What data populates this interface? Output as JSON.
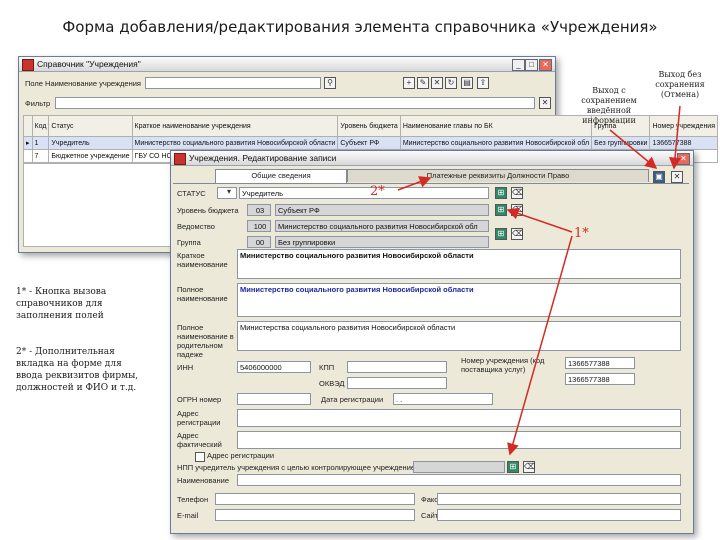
{
  "slide_title": "Форма добавления/редактирования  элемента справочника «Учреждения»",
  "ref_window": {
    "title": "Справочник \"Учреждения\"",
    "search_label": "Поле Наименование учреждения",
    "search_value": "",
    "filter_label": "Фильтр",
    "columns": [
      "Код",
      "Статус",
      "Краткое наименование учреждения",
      "Уровень бюджета",
      "Наименование главы по БК",
      "Группа",
      "Номер учреждения"
    ],
    "rows": [
      [
        "1",
        "Учредитель",
        "Министерство социального развития Новосибирской области",
        "Субъект РФ",
        "Министерство социального развития Новосибирской обл",
        "Без группировки",
        "1366577388"
      ],
      [
        "7",
        "Бюджетное учреждение",
        "ГБУ СО НСО Дом Ветеранов",
        "",
        "",
        "",
        ""
      ]
    ]
  },
  "edit_window": {
    "title": "Учреждения. Редактирование записи",
    "tabs": [
      "Общие сведения",
      "Платежные реквизиты Должности Право"
    ],
    "fields": {
      "status": {
        "label": "СТАТУС",
        "code": "",
        "value": "Учредитель"
      },
      "budget_level": {
        "label": "Уровень бюджета",
        "code": "03",
        "value": "Субъект РФ"
      },
      "department": {
        "label": "Ведомство",
        "code": "100",
        "value": "Министерство социального развития Новосибирской обл"
      },
      "group": {
        "label": "Группа",
        "code": "00",
        "value": "Без группировки"
      },
      "short_name": {
        "label": "Краткое наименование",
        "value": "Министерство социального развития Новосибирской области"
      },
      "full_name": {
        "label": "Полное наименование",
        "value": "Министерство социального развития Новосибирской области"
      },
      "name_rp": {
        "label": "Полное наименование в родительном падеже",
        "value": "Министерства социального развития Новосибирской области"
      },
      "inn": {
        "label": "ИНН",
        "value": "5406000000"
      },
      "kpp": {
        "label": "КПП",
        "value": ""
      },
      "okved": {
        "label": "ОКВЭД",
        "value": ""
      },
      "ogrn": {
        "label": "ОГРН номер",
        "value": ""
      },
      "reg_date": {
        "label": "Дата регистрации",
        "value": ". ."
      },
      "uch_num_label": "Номер учреждения (код поставщика услуг)",
      "uch_num_value": "1366577388",
      "uch_num_value2": "1366577388",
      "legal_address": {
        "label": "Адрес регистрации",
        "value": ""
      },
      "actual_address": {
        "label": "Адрес фактический",
        "value": ""
      },
      "same_address_label": "Адрес регистрации",
      "parent": {
        "label": "НПП учредитель учреждения с целью контролирующее учреждение",
        "value": ""
      },
      "name": {
        "label": "Наименование",
        "value": ""
      },
      "phone": {
        "label": "Телефон",
        "value": ""
      },
      "fax": {
        "label": "Факс",
        "value": ""
      },
      "email": {
        "label": "E-mail",
        "value": ""
      },
      "site": {
        "label": "Сайт",
        "value": ""
      }
    }
  },
  "callouts": {
    "save_exit": "Выход с сохранением введённой информации",
    "cancel_exit": "Выход без сохранения (Отмена)",
    "mark1": "1*",
    "mark2": "2*",
    "note1": "1* - Кнопка вызова справочников для заполнения полей",
    "note2": "2* - Дополнительная вкладка на форме для ввода реквизитов фирмы, должностей и ФИО и т.д."
  },
  "colors": {
    "arrow": "#d42a24",
    "window_bg": "#ece9d8"
  }
}
